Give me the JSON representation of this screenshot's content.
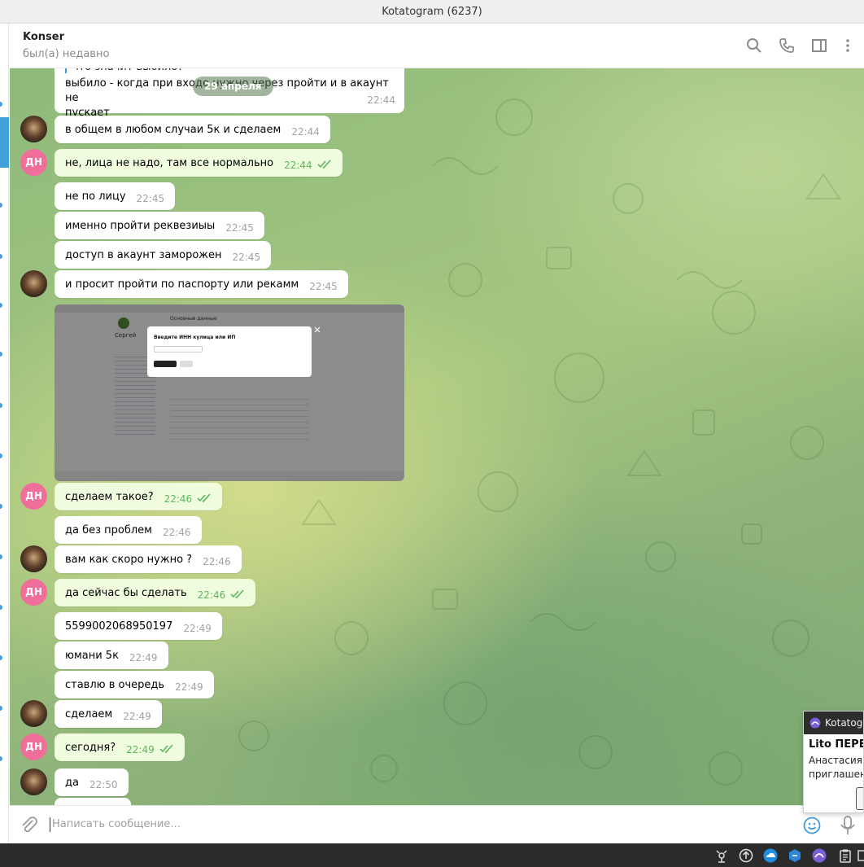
{
  "window": {
    "title": "Kotatogram (6237)"
  },
  "header": {
    "contact_name": "Konser",
    "contact_status": "был(а) недавно",
    "icons": [
      "search-icon",
      "phone-icon",
      "sidebar-toggle-icon",
      "more-vert-icon"
    ]
  },
  "chat": {
    "date_pill": "29 апреля",
    "quoted_preview": "что значит выбило?",
    "first_message": {
      "text_line1": "выбило - когда при входе нужно через пройти и в акаунт не",
      "text_line2": "пускает",
      "time": "22:44"
    },
    "messages": [
      {
        "text": "в общем в любом случаи 5к и сделаем",
        "time": "22:44",
        "out": false,
        "avatar": "photo"
      },
      {
        "text": "не, лица не надо, там все нормально",
        "time": "22:44",
        "out": true,
        "avatar": "ДН"
      },
      {
        "text": "не по лицу",
        "time": "22:45",
        "out": false,
        "avatar": ""
      },
      {
        "text": "именно пройти реквезиыы",
        "time": "22:45",
        "out": false,
        "avatar": ""
      },
      {
        "text": "доступ в акаунт заморожен",
        "time": "22:45",
        "out": false,
        "avatar": ""
      },
      {
        "text": "и просит пройти по паспорту или рекамм",
        "time": "22:45",
        "out": false,
        "avatar": "photo"
      },
      {
        "text": "сделаем такое?",
        "time": "22:46",
        "out": true,
        "avatar": "ДН"
      },
      {
        "text": "да без проблем",
        "time": "22:46",
        "out": false,
        "avatar": ""
      },
      {
        "text": "вам как скоро нужно ?",
        "time": "22:46",
        "out": false,
        "avatar": "photo"
      },
      {
        "text": "да сейчас бы сделать",
        "time": "22:46",
        "out": true,
        "avatar": "ДН"
      },
      {
        "text": "5599002068950197",
        "time": "22:49",
        "out": false,
        "avatar": ""
      },
      {
        "text": "юмани 5к",
        "time": "22:49",
        "out": false,
        "avatar": ""
      },
      {
        "text": "ставлю в очередь",
        "time": "22:49",
        "out": false,
        "avatar": ""
      },
      {
        "text": "сделаем",
        "time": "22:49",
        "out": false,
        "avatar": "photo"
      },
      {
        "text": "сегодня?",
        "time": "22:49",
        "out": true,
        "avatar": "ДН"
      },
      {
        "text": "да",
        "time": "22:50",
        "out": false,
        "avatar": "photo"
      }
    ],
    "screenshot_attachment": {
      "dialog_title": "Введите ИНН кулица или ИП",
      "profile_name": "Сергей",
      "tab_main": "Основные данные"
    }
  },
  "composer": {
    "placeholder": "Написать сообщение..."
  },
  "notification": {
    "app": "Kotatogram",
    "title": "Lito ПЕРЕ",
    "line1": "Анастасия",
    "line2": "приглашен"
  },
  "colors": {
    "accent": "#419fd9",
    "outgoing_bubble": "#effdde",
    "avatar_dn": "#f06e9a",
    "time_out": "#5fb75d"
  }
}
